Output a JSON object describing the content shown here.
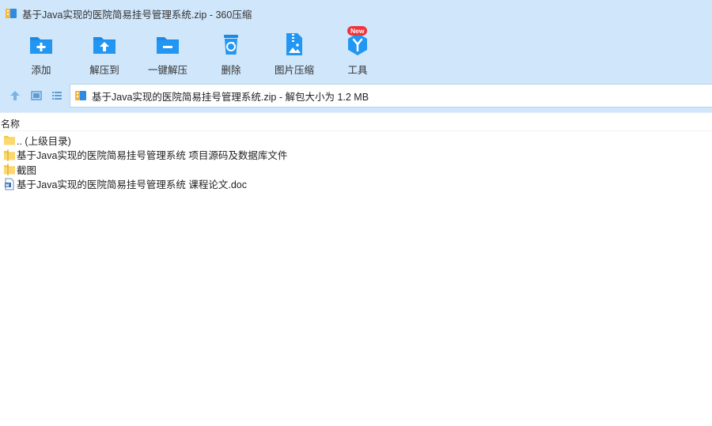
{
  "window": {
    "title": "基于Java实现的医院简易挂号管理系统.zip - 360压缩"
  },
  "toolbar": {
    "items": [
      {
        "label": "添加",
        "icon": "add-icon"
      },
      {
        "label": "解压到",
        "icon": "extract-to-icon"
      },
      {
        "label": "一键解压",
        "icon": "one-click-extract-icon"
      },
      {
        "label": "删除",
        "icon": "delete-icon"
      },
      {
        "label": "图片压缩",
        "icon": "image-compress-icon"
      },
      {
        "label": "工具",
        "icon": "tools-icon",
        "badge": "New"
      }
    ]
  },
  "navigation": {
    "address": "基于Java实现的医院简易挂号管理系统.zip - 解包大小为 1.2 MB"
  },
  "list": {
    "column_name": "名称",
    "items": [
      {
        "name": ".. (上级目录)",
        "type": "folder"
      },
      {
        "name": "基于Java实现的医院简易挂号管理系统 项目源码及数据库文件",
        "type": "folder"
      },
      {
        "name": "截图",
        "type": "folder"
      },
      {
        "name": "基于Java实现的医院简易挂号管理系统 课程论文.doc",
        "type": "doc"
      }
    ]
  },
  "colors": {
    "chrome": "#cfe6fb",
    "accent": "#1e88e5",
    "folder": "#f7c948",
    "badge": "#f0343a"
  }
}
